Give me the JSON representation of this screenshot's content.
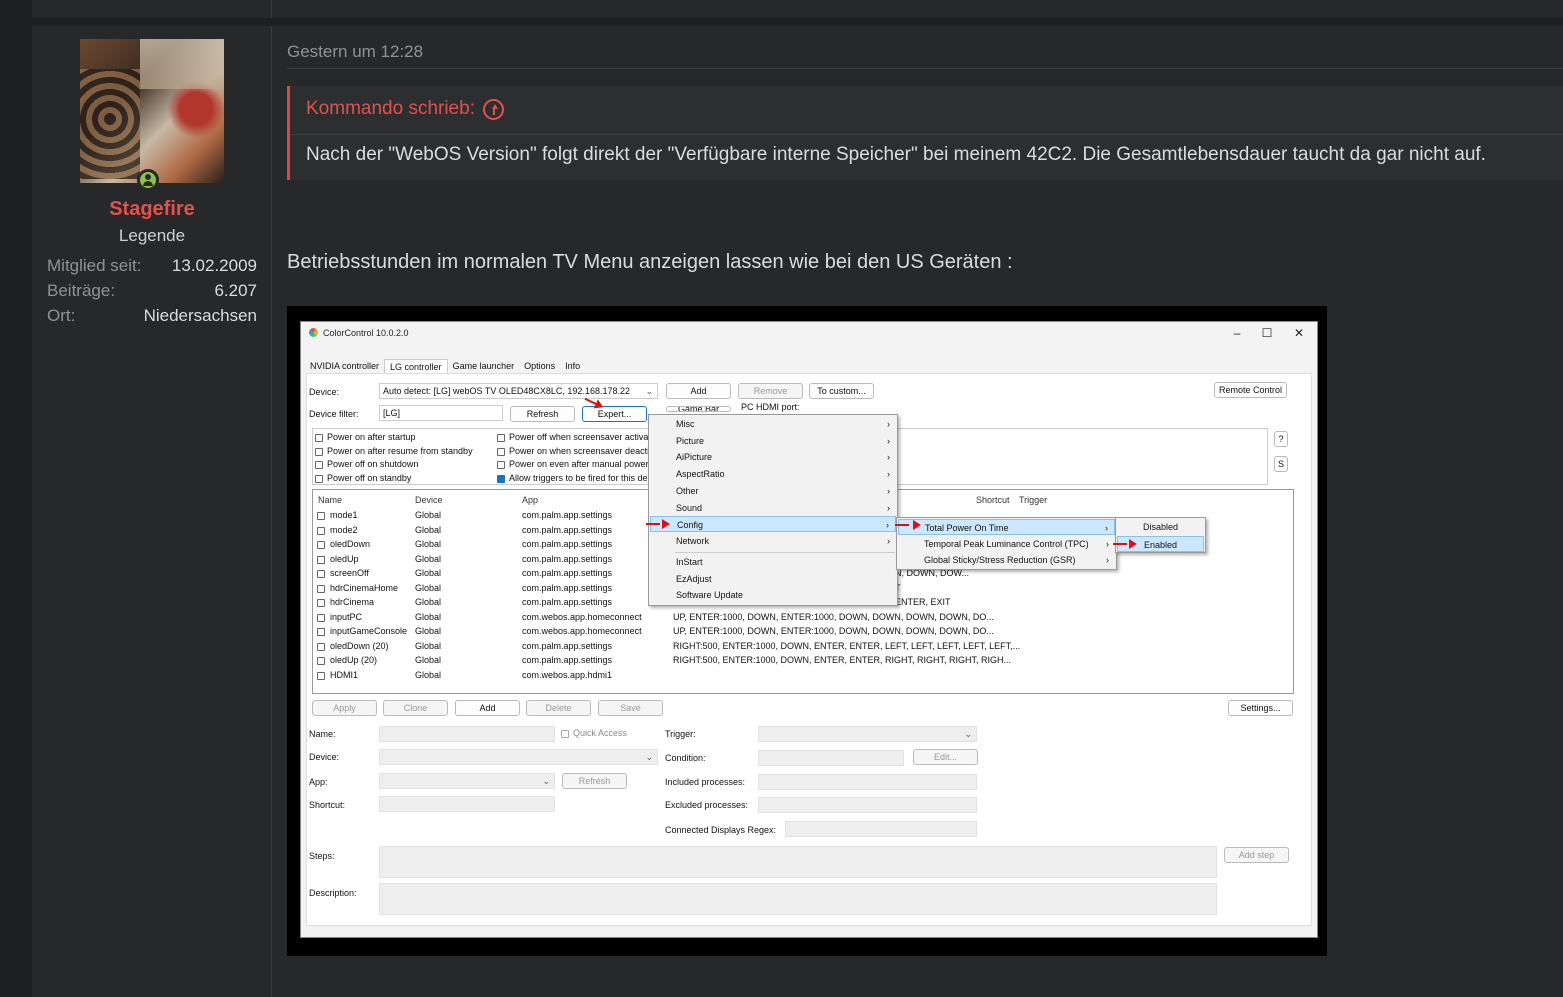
{
  "user": {
    "name": "Stagefire",
    "rank": "Legende",
    "stats": [
      {
        "key": "Mitglied seit:",
        "value": "13.02.2009"
      },
      {
        "key": "Beiträge:",
        "value": "6.207"
      },
      {
        "key": "Ort:",
        "value": "Niedersachsen"
      }
    ]
  },
  "post": {
    "date": "Gestern um 12:28",
    "quote_author": "Kommando schrieb:",
    "quote_text": "Nach der \"WebOS Version\" folgt direkt der \"Verfügbare interne Speicher\" bei meinem 42C2. Die Gesamtlebensdauer taucht da gar nicht auf.",
    "body": "Betriebsstunden im normalen TV Menu anzeigen lassen wie bei den US Geräten :"
  },
  "app": {
    "title": "ColorControl 10.0.2.0",
    "window_buttons": [
      "–",
      "☐",
      "✕"
    ],
    "tabs": [
      "NVIDIA controller",
      "LG controller",
      "Game launcher",
      "Options",
      "Info"
    ],
    "device_label": "Device:",
    "device_value": "Auto detect: [LG] webOS TV OLED48CX8LC, 192.168.178.22",
    "btn_add": "Add",
    "btn_remove": "Remove",
    "btn_to_custom": "To custom...",
    "btn_remote": "Remote Control",
    "filter_label": "Device filter:",
    "filter_value": "[LG]",
    "btn_refresh": "Refresh",
    "btn_expert": "Expert...",
    "btn_game_bar": "Game Bar",
    "pc_hdmi_label": "PC HDMI port:",
    "btn_q": "?",
    "btn_s": "S",
    "checks_left": [
      {
        "label": "Power on after startup",
        "checked": false
      },
      {
        "label": "Power on after resume from standby",
        "checked": false
      },
      {
        "label": "Power off on shutdown",
        "checked": false
      },
      {
        "label": "Power off on standby",
        "checked": false
      }
    ],
    "checks_mid": [
      {
        "label": "Power off when screensaver activat",
        "checked": false
      },
      {
        "label": "Power on when screensaver deactiv",
        "checked": false
      },
      {
        "label": "Power on even after manual power",
        "checked": false
      },
      {
        "label": "Allow triggers to be fired for this de",
        "checked": true
      }
    ],
    "table_headers": {
      "name": "Name",
      "device": "Device",
      "app": "App",
      "shortcut": "Shortcut",
      "trigger": "Trigger"
    },
    "rows": [
      {
        "name": "mode1",
        "device": "Global",
        "app": "com.palm.app.settings",
        "steps": ""
      },
      {
        "name": "mode2",
        "device": "Global",
        "app": "com.palm.app.settings",
        "steps": ""
      },
      {
        "name": "oledDown",
        "device": "Global",
        "app": "com.palm.app.settings",
        "steps": ""
      },
      {
        "name": "oledUp",
        "device": "Global",
        "app": "com.palm.app.settings",
        "steps": ""
      },
      {
        "name": "screenOff",
        "device": "Global",
        "app": "com.palm.app.settings",
        "steps": "N, DOWN, DOW..."
      },
      {
        "name": "hdrCinemaHome",
        "device": "Global",
        "app": "com.palm.app.settings",
        "steps": "T"
      },
      {
        "name": "hdrCinema",
        "device": "Global",
        "app": "com.palm.app.settings",
        "steps": "ENTER, EXIT"
      },
      {
        "name": "inputPC",
        "device": "Global",
        "app": "com.webos.app.homeconnect",
        "steps": "UP, ENTER:1000, DOWN, ENTER:1000, DOWN, DOWN, DOWN, DOWN, DO..."
      },
      {
        "name": "inputGameConsole",
        "device": "Global",
        "app": "com.webos.app.homeconnect",
        "steps": "UP, ENTER:1000, DOWN, ENTER:1000, DOWN, DOWN, DOWN, DOWN, DO..."
      },
      {
        "name": "oledDown (20)",
        "device": "Global",
        "app": "com.palm.app.settings",
        "steps": "RIGHT:500, ENTER:1000, DOWN, ENTER, ENTER, LEFT, LEFT, LEFT, LEFT, LEFT,..."
      },
      {
        "name": "oledUp (20)",
        "device": "Global",
        "app": "com.palm.app.settings",
        "steps": "RIGHT:500, ENTER:1000, DOWN, ENTER, ENTER, RIGHT, RIGHT, RIGHT, RIGH..."
      },
      {
        "name": "HDMI1",
        "device": "Global",
        "app": "com.webos.app.hdmi1",
        "steps": ""
      }
    ],
    "btn_apply": "Apply",
    "btn_clone": "Clone",
    "btn_add2": "Add",
    "btn_delete": "Delete",
    "btn_save": "Save",
    "btn_settings": "Settings...",
    "form": {
      "name": "Name:",
      "quick_access": "Quick Access",
      "trigger": "Trigger:",
      "device": "Device:",
      "condition": "Condition:",
      "btn_edit": "Edit...",
      "app": "App:",
      "btn_refresh": "Refresh",
      "included": "Included processes:",
      "shortcut": "Shortcut:",
      "excluded": "Excluded processes:",
      "regex": "Connected Displays Regex:",
      "steps": "Steps:",
      "btn_add_step": "Add step",
      "description": "Description:"
    },
    "menu1": [
      "Misc",
      "Picture",
      "AiPicture",
      "AspectRatio",
      "Other",
      "Sound",
      "Config",
      "Network"
    ],
    "menu1_extra": [
      "InStart",
      "EzAdjust",
      "Software Update"
    ],
    "menu2": [
      "Total Power On Time",
      "Temporal Peak Luminance Control (TPC)",
      "Global Sticky/Stress Reduction (GSR)"
    ],
    "menu3": [
      "Disabled",
      "Enabled"
    ],
    "submenu_glyph": "›"
  }
}
